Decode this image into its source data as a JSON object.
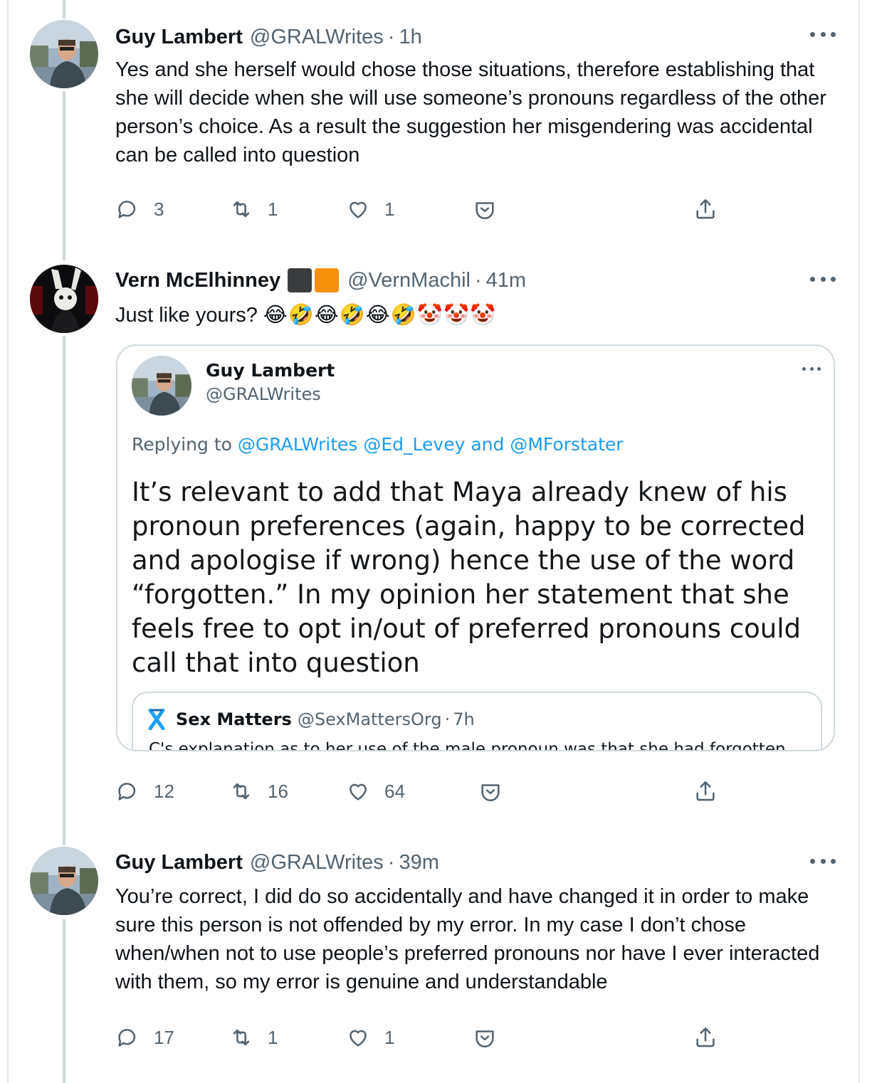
{
  "thread": [
    {
      "author": {
        "name": "Guy Lambert",
        "handle": "@GRALWrites",
        "time": "1h"
      },
      "text": "Yes and she herself would chose those situations, therefore establishing that she will decide when she will use someone’s pronouns regardless of the other person’s choice. As a result the suggestion her misgendering was accidental can be called into question",
      "actions": {
        "replies": "3",
        "retweets": "1",
        "likes": "1"
      }
    },
    {
      "author": {
        "name": "Vern McElhinney",
        "handle": "@VernMachil",
        "time": "41m",
        "flag_colors": [
          "#3a3c3e",
          "#f4900c"
        ]
      },
      "text": "Just like yours?",
      "emoji": "😂🤣😂🤣😂🤣🤡🤡🤡",
      "quoted": {
        "author": {
          "name": "Guy Lambert",
          "handle": "@GRALWrites"
        },
        "replying_label": "Replying to",
        "mentions": [
          "@GRALWrites",
          "@Ed_Levey",
          "@MForstater"
        ],
        "replying_and": "and",
        "text": "It’s relevant to add that Maya already knew of his pronoun preferences (again, happy to be corrected and apologise if wrong) hence the use of the word “forgotten.” In my opinion her statement that she feels free to opt in/out of preferred pronouns could call that into question",
        "nested": {
          "author": {
            "name": "Sex Matters",
            "handle": "@SexMattersOrg",
            "time": "7h"
          },
          "text": "C's explanation as to her use of the male pronoun was that she had forgotten"
        }
      },
      "actions": {
        "replies": "12",
        "retweets": "16",
        "likes": "64"
      }
    },
    {
      "author": {
        "name": "Guy Lambert",
        "handle": "@GRALWrites",
        "time": "39m"
      },
      "text": "You’re correct, I did do so accidentally and have changed it in order to make sure this person is not offended by my error. In my case I don’t chose when/when not to use people’s preferred pronouns nor have I ever interacted with them, so my error is genuine and understandable",
      "actions": {
        "replies": "17",
        "retweets": "1",
        "likes": "1"
      }
    }
  ],
  "colors": {
    "text": "#0f1419",
    "secondary": "#536471",
    "link": "#1d9bf0",
    "border": "#cfd9de",
    "sex_matters_logo": "#1da1f2"
  },
  "icons": [
    "reply-icon",
    "retweet-icon",
    "like-icon",
    "tip-icon",
    "share-icon",
    "more-icon"
  ]
}
